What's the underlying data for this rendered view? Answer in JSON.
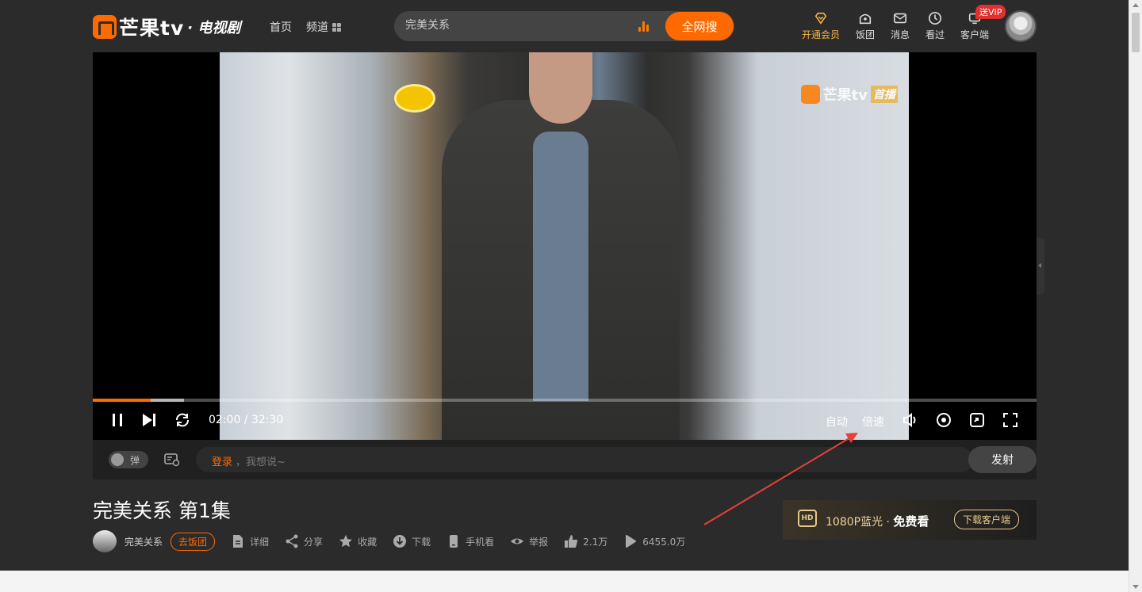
{
  "header": {
    "logo_text": "芒果tv",
    "logo_sub": "· 电视剧",
    "nav": {
      "home": "首页",
      "channel": "频道"
    },
    "search": {
      "value": "完美关系",
      "button": "全网搜"
    },
    "icons": [
      {
        "label": "开通会员",
        "icon": "diamond-icon"
      },
      {
        "label": "饭团",
        "icon": "fan-group-icon"
      },
      {
        "label": "消息",
        "icon": "message-icon"
      },
      {
        "label": "看过",
        "icon": "history-icon"
      },
      {
        "label": "客户端",
        "icon": "client-icon"
      }
    ],
    "vip_badge": "送VIP"
  },
  "player": {
    "time": "02:00 / 32:30",
    "quality": "自动",
    "speed": "倍速",
    "progress_played": 0.0615,
    "progress_buffered": 0.097,
    "watermark": "芒果tv",
    "watermark_tag": "首播"
  },
  "danmaku": {
    "toggle_label": "弹",
    "login": "登录",
    "placeholder": "，我想说~",
    "send": "发射"
  },
  "info": {
    "title": "完美关系 第1集",
    "uploader": "完美关系",
    "fan_button": "去饭团",
    "actions": {
      "detail": "详细",
      "share": "分享",
      "collect": "收藏",
      "download": "下载",
      "mobile": "手机看",
      "report": "举报",
      "likes": "2.1万",
      "plays": "6455.0万"
    }
  },
  "banner": {
    "hd": "HD",
    "text": "1080P蓝光 · ",
    "text_bold": "免费看",
    "button": "下载客户端"
  },
  "colors": {
    "accent": "#ff6a00",
    "vip": "#f4b545",
    "annotation": "#e8403a"
  }
}
